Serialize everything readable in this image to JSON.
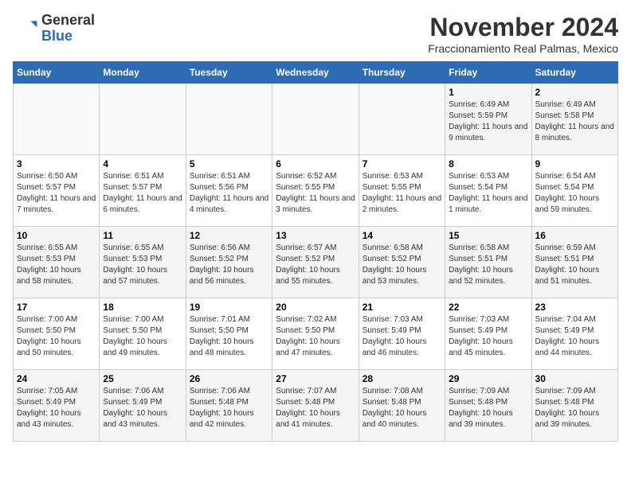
{
  "header": {
    "logo_line1": "General",
    "logo_line2": "Blue",
    "month_title": "November 2024",
    "subtitle": "Fraccionamiento Real Palmas, Mexico"
  },
  "weekdays": [
    "Sunday",
    "Monday",
    "Tuesday",
    "Wednesday",
    "Thursday",
    "Friday",
    "Saturday"
  ],
  "weeks": [
    [
      {
        "day": "",
        "info": ""
      },
      {
        "day": "",
        "info": ""
      },
      {
        "day": "",
        "info": ""
      },
      {
        "day": "",
        "info": ""
      },
      {
        "day": "",
        "info": ""
      },
      {
        "day": "1",
        "info": "Sunrise: 6:49 AM\nSunset: 5:59 PM\nDaylight: 11 hours and 9 minutes."
      },
      {
        "day": "2",
        "info": "Sunrise: 6:49 AM\nSunset: 5:58 PM\nDaylight: 11 hours and 8 minutes."
      }
    ],
    [
      {
        "day": "3",
        "info": "Sunrise: 6:50 AM\nSunset: 5:57 PM\nDaylight: 11 hours and 7 minutes."
      },
      {
        "day": "4",
        "info": "Sunrise: 6:51 AM\nSunset: 5:57 PM\nDaylight: 11 hours and 6 minutes."
      },
      {
        "day": "5",
        "info": "Sunrise: 6:51 AM\nSunset: 5:56 PM\nDaylight: 11 hours and 4 minutes."
      },
      {
        "day": "6",
        "info": "Sunrise: 6:52 AM\nSunset: 5:55 PM\nDaylight: 11 hours and 3 minutes."
      },
      {
        "day": "7",
        "info": "Sunrise: 6:53 AM\nSunset: 5:55 PM\nDaylight: 11 hours and 2 minutes."
      },
      {
        "day": "8",
        "info": "Sunrise: 6:53 AM\nSunset: 5:54 PM\nDaylight: 11 hours and 1 minute."
      },
      {
        "day": "9",
        "info": "Sunrise: 6:54 AM\nSunset: 5:54 PM\nDaylight: 10 hours and 59 minutes."
      }
    ],
    [
      {
        "day": "10",
        "info": "Sunrise: 6:55 AM\nSunset: 5:53 PM\nDaylight: 10 hours and 58 minutes."
      },
      {
        "day": "11",
        "info": "Sunrise: 6:55 AM\nSunset: 5:53 PM\nDaylight: 10 hours and 57 minutes."
      },
      {
        "day": "12",
        "info": "Sunrise: 6:56 AM\nSunset: 5:52 PM\nDaylight: 10 hours and 56 minutes."
      },
      {
        "day": "13",
        "info": "Sunrise: 6:57 AM\nSunset: 5:52 PM\nDaylight: 10 hours and 55 minutes."
      },
      {
        "day": "14",
        "info": "Sunrise: 6:58 AM\nSunset: 5:52 PM\nDaylight: 10 hours and 53 minutes."
      },
      {
        "day": "15",
        "info": "Sunrise: 6:58 AM\nSunset: 5:51 PM\nDaylight: 10 hours and 52 minutes."
      },
      {
        "day": "16",
        "info": "Sunrise: 6:59 AM\nSunset: 5:51 PM\nDaylight: 10 hours and 51 minutes."
      }
    ],
    [
      {
        "day": "17",
        "info": "Sunrise: 7:00 AM\nSunset: 5:50 PM\nDaylight: 10 hours and 50 minutes."
      },
      {
        "day": "18",
        "info": "Sunrise: 7:00 AM\nSunset: 5:50 PM\nDaylight: 10 hours and 49 minutes."
      },
      {
        "day": "19",
        "info": "Sunrise: 7:01 AM\nSunset: 5:50 PM\nDaylight: 10 hours and 48 minutes."
      },
      {
        "day": "20",
        "info": "Sunrise: 7:02 AM\nSunset: 5:50 PM\nDaylight: 10 hours and 47 minutes."
      },
      {
        "day": "21",
        "info": "Sunrise: 7:03 AM\nSunset: 5:49 PM\nDaylight: 10 hours and 46 minutes."
      },
      {
        "day": "22",
        "info": "Sunrise: 7:03 AM\nSunset: 5:49 PM\nDaylight: 10 hours and 45 minutes."
      },
      {
        "day": "23",
        "info": "Sunrise: 7:04 AM\nSunset: 5:49 PM\nDaylight: 10 hours and 44 minutes."
      }
    ],
    [
      {
        "day": "24",
        "info": "Sunrise: 7:05 AM\nSunset: 5:49 PM\nDaylight: 10 hours and 43 minutes."
      },
      {
        "day": "25",
        "info": "Sunrise: 7:06 AM\nSunset: 5:49 PM\nDaylight: 10 hours and 43 minutes."
      },
      {
        "day": "26",
        "info": "Sunrise: 7:06 AM\nSunset: 5:48 PM\nDaylight: 10 hours and 42 minutes."
      },
      {
        "day": "27",
        "info": "Sunrise: 7:07 AM\nSunset: 5:48 PM\nDaylight: 10 hours and 41 minutes."
      },
      {
        "day": "28",
        "info": "Sunrise: 7:08 AM\nSunset: 5:48 PM\nDaylight: 10 hours and 40 minutes."
      },
      {
        "day": "29",
        "info": "Sunrise: 7:09 AM\nSunset: 5:48 PM\nDaylight: 10 hours and 39 minutes."
      },
      {
        "day": "30",
        "info": "Sunrise: 7:09 AM\nSunset: 5:48 PM\nDaylight: 10 hours and 39 minutes."
      }
    ]
  ]
}
